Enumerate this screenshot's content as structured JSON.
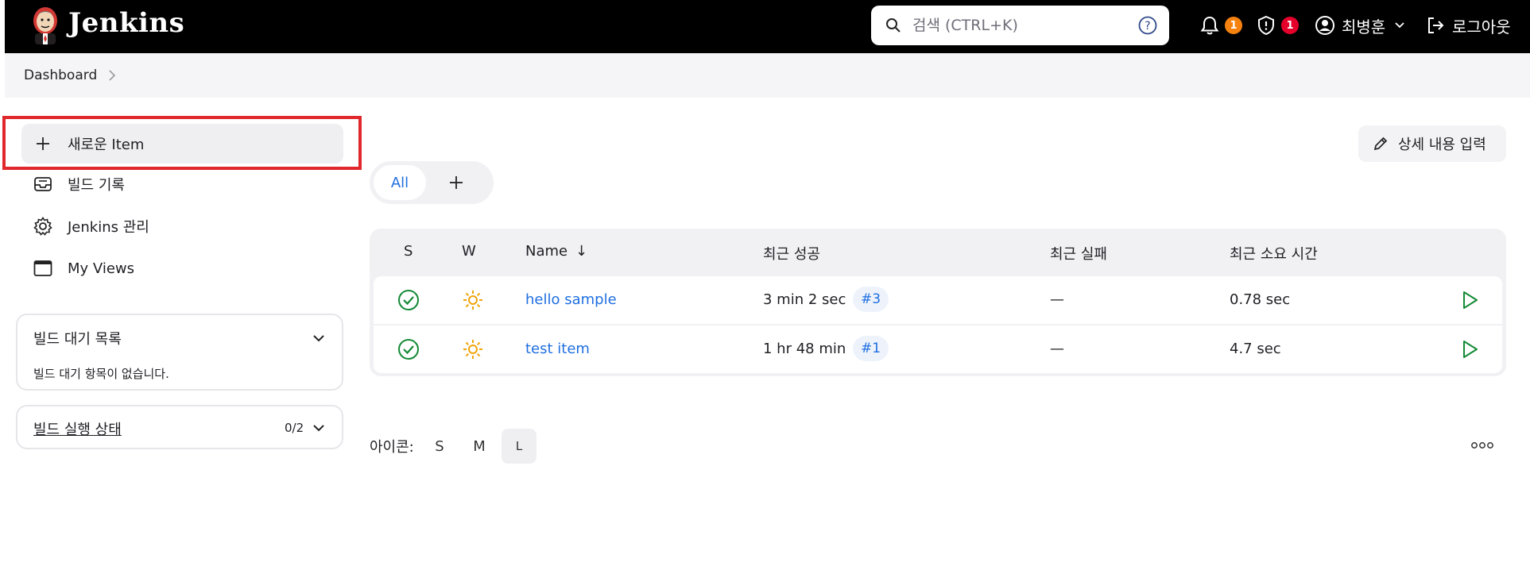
{
  "header": {
    "brand": "Jenkins",
    "search_placeholder": "검색 (CTRL+K)",
    "notifications_count": "1",
    "security_count": "1",
    "user_name": "최병훈",
    "logout_label": "로그아웃",
    "colors": {
      "bar": "#000000",
      "notification_badge": "#f5820f",
      "security_badge": "#e4002b"
    }
  },
  "breadcrumb": {
    "items": [
      "Dashboard"
    ]
  },
  "sidebar": {
    "items": [
      {
        "label": "새로운 Item",
        "icon": "plus-icon"
      },
      {
        "label": "빌드 기록",
        "icon": "inbox-icon"
      },
      {
        "label": "Jenkins 관리",
        "icon": "gear-icon"
      },
      {
        "label": "My Views",
        "icon": "window-icon"
      }
    ],
    "queue": {
      "title": "빌드 대기 목록",
      "empty_text": "빌드 대기 항목이 없습니다."
    },
    "executors": {
      "title": "빌드 실행 상태",
      "count": "0/2"
    }
  },
  "main": {
    "edit_description_label": "상세 내용 입력",
    "view_tabs": [
      {
        "label": "All",
        "active": true
      }
    ],
    "table": {
      "headers": {
        "status": "S",
        "weather": "W",
        "name": "Name",
        "sort_arrow": "↓",
        "last_success": "최근 성공",
        "last_failure": "최근 실패",
        "last_duration": "최근 소요 시간"
      },
      "rows": [
        {
          "name": "hello sample",
          "last_success": "3 min 2 sec",
          "build": "#3",
          "last_failure": "—",
          "duration": "0.78 sec",
          "status": "success",
          "weather": "sunny"
        },
        {
          "name": "test item",
          "last_success": "1 hr 48 min",
          "build": "#1",
          "last_failure": "—",
          "duration": "4.7 sec",
          "status": "success",
          "weather": "sunny"
        }
      ]
    },
    "icon_size": {
      "label": "아이콘:",
      "options": [
        "S",
        "M",
        "L"
      ],
      "selected": "L"
    }
  }
}
